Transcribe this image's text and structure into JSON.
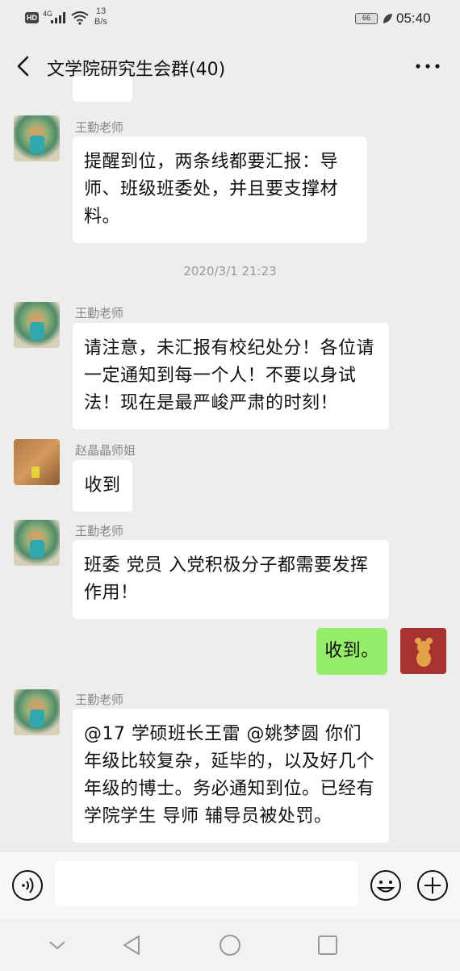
{
  "status_bar": {
    "hd_badge": "HD",
    "network": "4G",
    "speed_value": "13",
    "speed_unit": "B/s",
    "battery": "66",
    "time": "05:40"
  },
  "header": {
    "title": "文学院研究生会群(40)"
  },
  "messages": [
    {
      "sender": "王勤老师",
      "text": "提醒到位，两条线都要汇报：导师、班级班委处，并且要支撑材料。"
    },
    {
      "timestamp": "2020/3/1 21:23"
    },
    {
      "sender": "王勤老师",
      "text": "请注意，未汇报有校纪处分！各位请一定通知到每一个人！不要以身试法！现在是最严峻严肃的时刻！"
    },
    {
      "sender": "赵晶晶师姐",
      "text": "收到"
    },
    {
      "sender": "王勤老师",
      "text": "班委 党员 入党积极分子都需要发挥作用！"
    },
    {
      "sender": "me",
      "text": "收到。"
    },
    {
      "sender": "王勤老师",
      "text": "@17 学硕班长王雷  @姚梦圆  你们年级比较复杂，延毕的，以及好几个年级的博士。务必通知到位。已经有学院学生 导师 辅导员被处罚。"
    }
  ],
  "icons": {
    "back": "chevron-left-icon",
    "more": "more-dots-icon",
    "voice": "voice-icon",
    "emoji": "emoji-icon",
    "plus": "plus-icon"
  },
  "colors": {
    "background": "#ededed",
    "bubble_other": "#ffffff",
    "bubble_self": "#95ec69"
  }
}
